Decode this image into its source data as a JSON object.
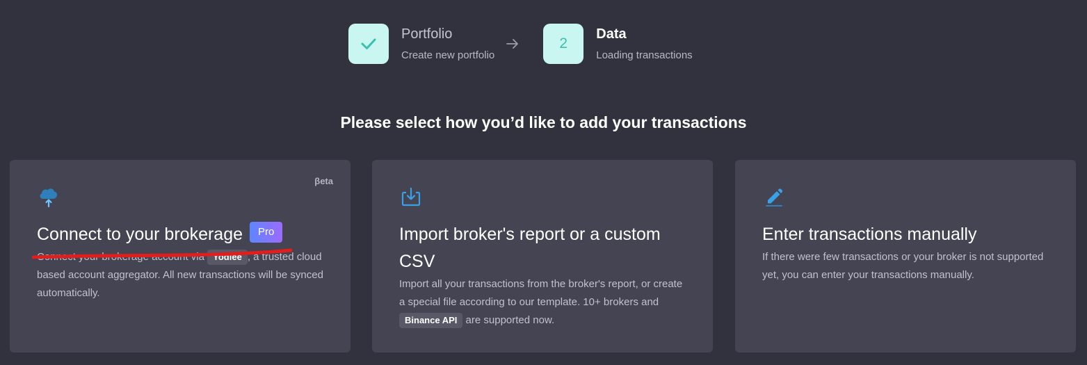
{
  "stepper": {
    "steps": [
      {
        "title": "Portfolio",
        "subtitle": "Create new portfolio",
        "state": "done",
        "icon": "check-icon"
      },
      {
        "title": "Data",
        "subtitle": "Loading transactions",
        "state": "active",
        "number": "2"
      }
    ]
  },
  "heading": "Please select how you’d like to add your transactions",
  "cards": [
    {
      "title": "Connect to your brokerage",
      "badge": "Pro",
      "beta": "βeta",
      "desc_before": "Connect your brokerage account via ",
      "chip": "Yodlee",
      "desc_after": ", a trusted cloud based account aggregator. All new transactions will be synced automatically.",
      "icon": "cloud-upload-icon"
    },
    {
      "title": "Import broker's report or a custom CSV",
      "desc_before": "Import all your transactions from the broker's report, or create a special file according to our template. 10+ brokers and ",
      "chip": "Binance API",
      "desc_after": " are supported now.",
      "icon": "import-icon"
    },
    {
      "title": "Enter transactions manually",
      "desc": "If there were few transactions or your broker is not supported yet, you can enter your transactions manually.",
      "icon": "pencil-icon"
    }
  ],
  "colors": {
    "background": "#32323f",
    "card": "#444452",
    "step_box": "#c9f6f0",
    "step_accent": "#3bbfae",
    "icon_accent": "#3aa0e8",
    "redaction": "#e01e1e"
  }
}
